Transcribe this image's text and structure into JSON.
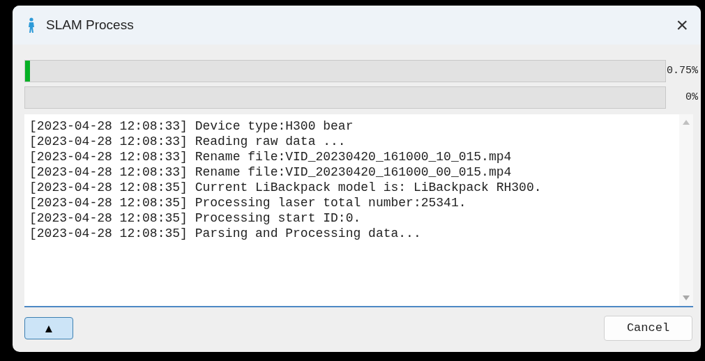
{
  "window": {
    "title": "SLAM Process",
    "close": "×"
  },
  "progress": [
    {
      "level": 0.0075,
      "reading": "0.75%"
    },
    {
      "level": 0,
      "reading": "0%"
    }
  ],
  "log": [
    "[2023-04-28 12:08:33] Device type:H300 bear",
    "[2023-04-28 12:08:33] Reading raw data ...",
    "[2023-04-28 12:08:33] Rename file:VID_20230420_161000_10_015.mp4",
    "[2023-04-28 12:08:33] Rename file:VID_20230420_161000_00_015.mp4",
    "[2023-04-28 12:08:35] Current LiBackpack model is: LiBackpack RH300.",
    "[2023-04-28 12:08:35] Processing laser total number:25341.",
    "[2023-04-28 12:08:35] Processing start ID:0.",
    "[2023-04-28 12:08:35] Parsing and Processing data..."
  ],
  "buttons": {
    "collapse": "▲",
    "cancel": "Cancel"
  }
}
